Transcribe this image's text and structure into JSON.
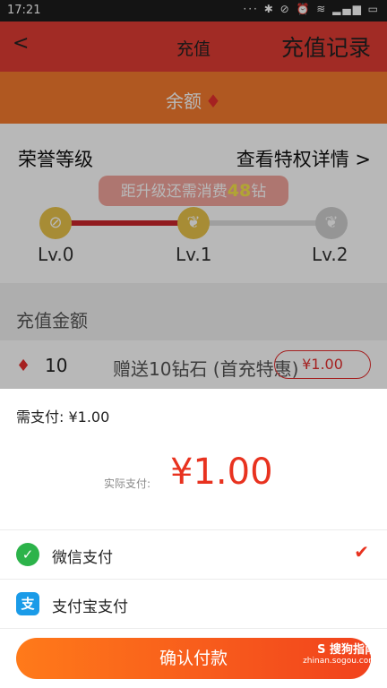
{
  "status_bar": {
    "time": "17:21",
    "icons": [
      "…",
      "bluetooth-icon",
      "silent-icon",
      "alarm-icon",
      "wifi-icon",
      "signal-icon",
      "battery-icon"
    ]
  },
  "header": {
    "back": "<",
    "title": "充值",
    "records": "充值记录"
  },
  "balance": {
    "label": "余额",
    "gem": "♦"
  },
  "level": {
    "honor": "荣誉等级",
    "details": "查看特权详情 >",
    "pill_prefix": "距升级还需消费",
    "pill_amount": "48",
    "pill_suffix": "钻",
    "levels": [
      "Lv.0",
      "Lv.1",
      "Lv.2"
    ],
    "progress_fraction": 0.5
  },
  "recharge": {
    "title": "充值金额",
    "row": {
      "diamonds": "10",
      "gift": "赠送10钻石 (首充特惠)",
      "price": "¥1.00"
    }
  },
  "sheet": {
    "need_pay": "需支付: ¥1.00",
    "actual_label": "实际支付:",
    "actual_value": "¥1.00",
    "options": [
      {
        "label": "微信支付",
        "selected": true
      },
      {
        "label": "支付宝支付",
        "selected": false
      }
    ],
    "confirm": "确认付款"
  },
  "watermark": {
    "brand": "S 搜狗指南",
    "url": "zhinan.sogou.com"
  },
  "colors": {
    "accent": "#e8321f",
    "header": "#e03c34",
    "balance": "#f47a2e"
  }
}
